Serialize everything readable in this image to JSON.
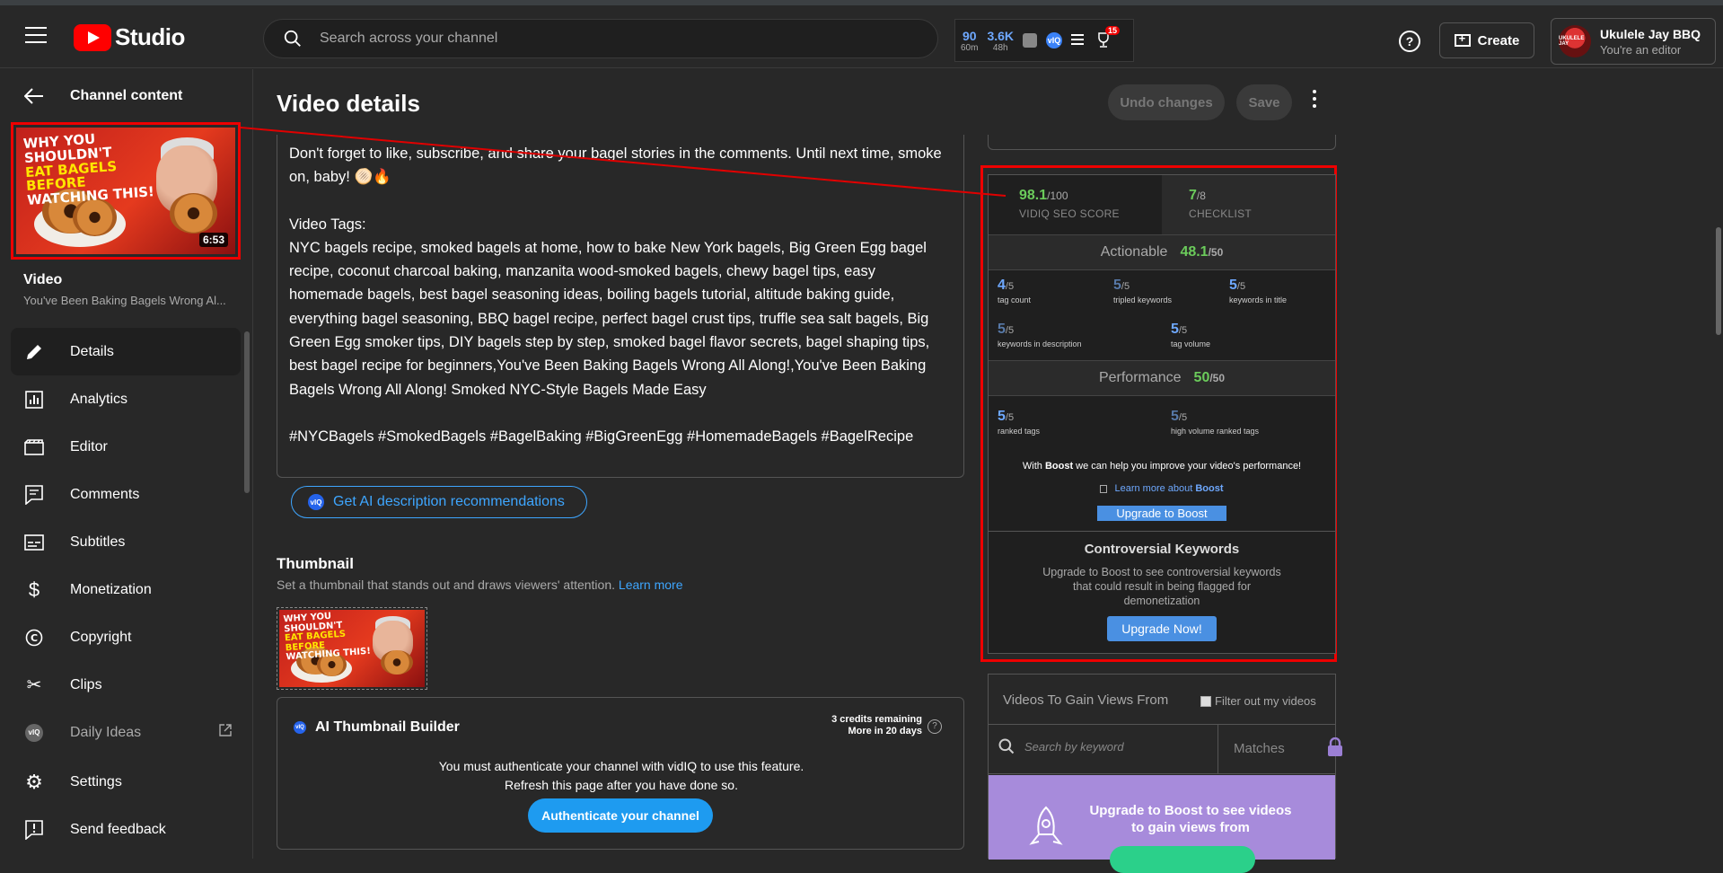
{
  "header": {
    "logo_text": "Studio",
    "search_placeholder": "Search across your channel",
    "stats": [
      {
        "value": "90",
        "label": "60m"
      },
      {
        "value": "3.6K",
        "label": "48h"
      }
    ],
    "notification_count": "15",
    "create_label": "Create",
    "account_name": "Ukulele Jay BBQ",
    "account_role": "You're an editor",
    "avatar_text": "UKULELE JAY"
  },
  "sidebar": {
    "back_label": "Channel content",
    "thumbnail_duration": "6:53",
    "thumbnail_lines": [
      "WHY YOU SHOULDN'T",
      "EAT BAGELS BEFORE",
      "WATCHING THIS!"
    ],
    "video_label": "Video",
    "video_title": "You've Been Baking Bagels Wrong Al...",
    "nav": [
      {
        "label": "Details",
        "icon": "pencil-icon"
      },
      {
        "label": "Analytics",
        "icon": "analytics-icon"
      },
      {
        "label": "Editor",
        "icon": "clapperboard-icon"
      },
      {
        "label": "Comments",
        "icon": "comments-icon"
      },
      {
        "label": "Subtitles",
        "icon": "subtitles-icon"
      },
      {
        "label": "Monetization",
        "icon": "dollar-icon"
      },
      {
        "label": "Copyright",
        "icon": "copyright-icon"
      },
      {
        "label": "Clips",
        "icon": "scissors-icon"
      },
      {
        "label": "Daily Ideas",
        "icon": "vidiq-icon"
      },
      {
        "label": "Settings",
        "icon": "gear-icon"
      },
      {
        "label": "Send feedback",
        "icon": "feedback-icon"
      }
    ]
  },
  "main": {
    "title": "Video details",
    "undo_label": "Undo changes",
    "save_label": "Save",
    "description": {
      "para1": "Don't forget to like, subscribe, and share your bagel stories in the comments. Until next time, smoke on, baby! 🫓🔥",
      "tags_heading": "Video Tags:",
      "tags": "NYC bagels recipe, smoked bagels at home, how to bake New York bagels, Big Green Egg bagel recipe, coconut charcoal baking, manzanita wood-smoked bagels, chewy bagel tips, easy homemade bagels, best bagel seasoning ideas, boiling bagels tutorial, altitude baking guide, everything bagel seasoning, BBQ bagel recipe, perfect bagel crust tips, truffle sea salt bagels, Big Green Egg smoker tips, DIY bagels step by step, smoked bagel flavor secrets, bagel shaping tips, best bagel recipe for beginners,You've Been Baking Bagels Wrong All Along!,You've Been Baking Bagels Wrong All Along! Smoked NYC-Style Bagels Made Easy",
      "hashtags": "#NYCBagels #SmokedBagels #BagelBaking #BigGreenEgg #HomemadeBagels #BagelRecipe"
    },
    "ai_desc_label": "Get AI description recommendations",
    "thumbnail_title": "Thumbnail",
    "thumbnail_sub": "Set a thumbnail that stands out and draws viewers' attention.",
    "learn_more": "Learn more",
    "ai_thumb": {
      "title": "AI Thumbnail Builder",
      "credits": "3 credits remaining",
      "credits_sub": "More in 20 days",
      "msg1": "You must authenticate your channel with vidIQ to use this feature.",
      "msg2": "Refresh this page after you have done so.",
      "button": "Authenticate your channel"
    }
  },
  "seo": {
    "score_value": "98.1",
    "score_max": "/100",
    "score_label": "VIDIQ SEO SCORE",
    "checklist_value": "7",
    "checklist_max": "/8",
    "checklist_label": "CHECKLIST",
    "actionable_label": "Actionable",
    "actionable_value": "48.1",
    "actionable_max": "/50",
    "actionable_metrics": [
      {
        "value": "4",
        "max": "/5",
        "label": "tag count"
      },
      {
        "value": "5",
        "max": "/5",
        "label": "tripled keywords"
      },
      {
        "value": "5",
        "max": "/5",
        "label": "keywords in title"
      },
      {
        "value": "5",
        "max": "/5",
        "label": "keywords in description"
      },
      {
        "value": "5",
        "max": "/5",
        "label": "tag volume"
      }
    ],
    "performance_label": "Performance",
    "performance_value": "50",
    "performance_max": "/50",
    "performance_metrics": [
      {
        "value": "5",
        "max": "/5",
        "label": "ranked tags"
      },
      {
        "value": "5",
        "max": "/5",
        "label": "high volume ranked tags"
      }
    ],
    "boost_pre": "With ",
    "boost_word": "Boost",
    "boost_post": " we can help you improve your video's performance!",
    "learn_pre": "Learn more about ",
    "learn_word": "Boost",
    "upgrade_boost": "Upgrade to Boost",
    "contro_title": "Controversial Keywords",
    "contro_text": "Upgrade to Boost to see controversial keywords that could result in being flagged for demonetization",
    "upgrade_now": "Upgrade Now!"
  },
  "gain": {
    "title": "Videos To Gain Views From",
    "filter_label": "Filter out my videos",
    "keyword_placeholder": "Search by keyword",
    "matches_label": "Matches",
    "promo_pre": "Upgrade to ",
    "promo_word": "Boost",
    "promo_post": " to see videos to gain views from"
  },
  "colors": {
    "accent_blue": "#3ea6ff",
    "score_green": "#6bcb5b",
    "highlight_red": "#e00000",
    "boost_purple": "#a78bdb"
  }
}
